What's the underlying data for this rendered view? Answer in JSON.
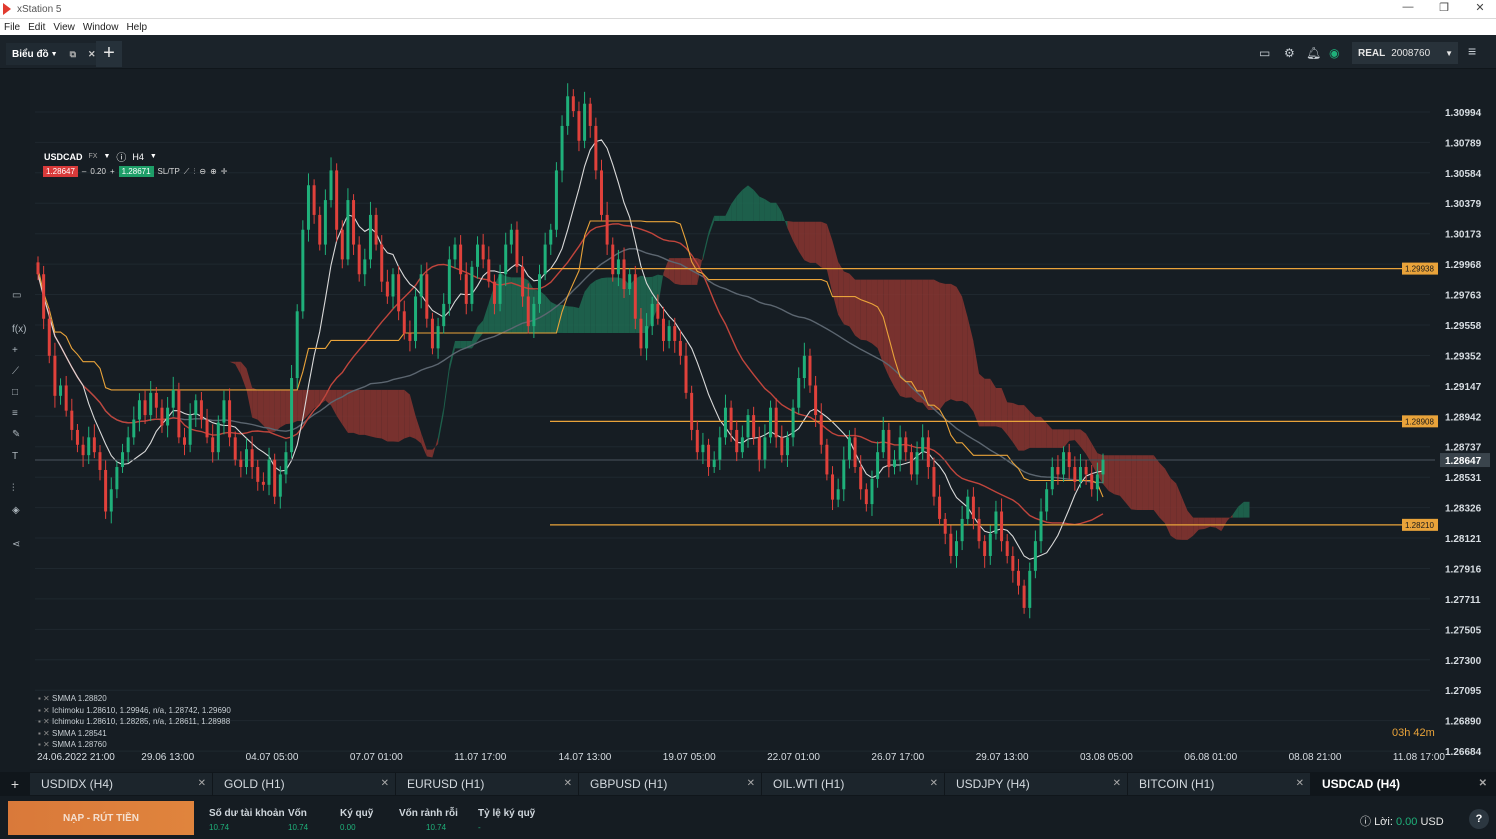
{
  "window": {
    "title": "xStation 5",
    "controls": [
      "—",
      "❐",
      "✕"
    ]
  },
  "menu": [
    "File",
    "Edit",
    "View",
    "Window",
    "Help"
  ],
  "toolbar": {
    "tab_label": "Biểu đồ",
    "account_type": "REAL",
    "account_number": "2008760"
  },
  "instrument": {
    "symbol": "USDCAD",
    "market": "FX",
    "timeframe": "H4",
    "sell": "1.28647",
    "spread": "0.20",
    "buy": "1.28671",
    "sltp": "SL/TP"
  },
  "legend": [
    "SMMA 1.28820",
    "Ichimoku 1.28610, 1.29946, n/a, 1.28742, 1.29690",
    "Ichimoku 1.28610, 1.28285, n/a, 1.28611, 1.28988",
    "SMMA 1.28541",
    "SMMA 1.28760"
  ],
  "countdown": "03h 42m",
  "chart_data": {
    "type": "candlestick",
    "title": "USDCAD (H4)",
    "y_ticks": [
      "1.30994",
      "1.30789",
      "1.30584",
      "1.30379",
      "1.30173",
      "1.29968",
      "1.29763",
      "1.29558",
      "1.29352",
      "1.29147",
      "1.28942",
      "1.28737",
      "1.28531",
      "1.28326",
      "1.28121",
      "1.27916",
      "1.27711",
      "1.27505",
      "1.27300",
      "1.27095",
      "1.26890",
      "1.26684"
    ],
    "y_range": [
      1.26684,
      1.31123
    ],
    "x_ticks": [
      "24.06.2022 21:00",
      "29.06 13:00",
      "04.07 05:00",
      "07.07 01:00",
      "11.07 17:00",
      "14.07 13:00",
      "19.07 05:00",
      "22.07 01:00",
      "26.07 17:00",
      "29.07 13:00",
      "03.08 05:00",
      "06.08 01:00",
      "08.08 21:00",
      "11.08 17:00"
    ],
    "current_price": "1.28647",
    "horizontal_lines": [
      {
        "label": "1.29938",
        "value": 1.29938,
        "color": "#e9a33a"
      },
      {
        "label": "1.28908",
        "value": 1.28908,
        "color": "#e9a33a"
      },
      {
        "label": "1.28210",
        "value": 1.2821,
        "color": "#e9a33a"
      }
    ],
    "colors": {
      "up": "#1fb07a",
      "down": "#e0413b",
      "cloud_up": "#1f6b52",
      "cloud_down": "#8a3530",
      "sma_white": "#d9d9d9",
      "sma_orange": "#e9a33a",
      "sma_red": "#c0453c",
      "sma_gray": "#5c6670"
    },
    "closes": [
      1.299,
      1.296,
      1.2935,
      1.2908,
      1.2915,
      1.2898,
      1.2885,
      1.2875,
      1.2868,
      1.288,
      1.287,
      1.2858,
      1.283,
      1.2845,
      1.286,
      1.287,
      1.288,
      1.2892,
      1.2905,
      1.2895,
      1.291,
      1.29,
      1.2888,
      1.29,
      1.2912,
      1.288,
      1.2875,
      1.2895,
      1.2905,
      1.2892,
      1.288,
      1.287,
      1.289,
      1.2905,
      1.288,
      1.2865,
      1.286,
      1.2872,
      1.286,
      1.285,
      1.2848,
      1.2865,
      1.284,
      1.2855,
      1.287,
      1.292,
      1.2965,
      1.302,
      1.305,
      1.303,
      1.301,
      1.304,
      1.306,
      1.302,
      1.3,
      1.304,
      1.301,
      1.299,
      1.3,
      1.303,
      1.301,
      1.2985,
      1.2975,
      1.299,
      1.2965,
      1.295,
      1.2945,
      1.2975,
      1.299,
      1.296,
      1.294,
      1.2955,
      1.297,
      1.3,
      1.301,
      1.299,
      1.297,
      1.2995,
      1.301,
      1.3,
      1.2985,
      1.297,
      1.299,
      1.301,
      1.302,
      1.2995,
      1.2975,
      1.2955,
      1.297,
      1.299,
      1.301,
      1.302,
      1.306,
      1.309,
      1.311,
      1.31,
      1.308,
      1.3105,
      1.309,
      1.306,
      1.303,
      1.301,
      1.299,
      1.3,
      1.298,
      1.299,
      1.296,
      1.294,
      1.2955,
      1.297,
      1.296,
      1.2945,
      1.2955,
      1.2945,
      1.2935,
      1.291,
      1.2885,
      1.287,
      1.2875,
      1.286,
      1.2865,
      1.288,
      1.29,
      1.2885,
      1.287,
      1.288,
      1.2895,
      1.288,
      1.2865,
      1.288,
      1.29,
      1.288,
      1.2868,
      1.288,
      1.29,
      1.292,
      1.2935,
      1.2915,
      1.2895,
      1.2875,
      1.2855,
      1.2838,
      1.2845,
      1.2865,
      1.288,
      1.286,
      1.2845,
      1.2835,
      1.2852,
      1.287,
      1.2885,
      1.286,
      1.2865,
      1.288,
      1.287,
      1.2855,
      1.287,
      1.288,
      1.286,
      1.284,
      1.2825,
      1.2815,
      1.28,
      1.281,
      1.2825,
      1.284,
      1.2825,
      1.281,
      1.28,
      1.2815,
      1.283,
      1.281,
      1.28,
      1.279,
      1.278,
      1.2765,
      1.279,
      1.281,
      1.283,
      1.2845,
      1.286,
      1.2855,
      1.287,
      1.286,
      1.285,
      1.286,
      1.2855,
      1.2845,
      1.2855,
      1.2865
    ]
  },
  "bottom_tabs": [
    "USDIDX (H4)",
    "GOLD (H1)",
    "EURUSD (H1)",
    "GBPUSD (H1)",
    "OIL.WTI (H1)",
    "USDJPY (H4)",
    "BITCOIN (H1)",
    "USDCAD (H4)"
  ],
  "footer": {
    "deposit_label": "NẠP - RÚT TIỀN",
    "stats": [
      {
        "label": "Số dư tài khoản",
        "value": "10.74"
      },
      {
        "label": "Vốn",
        "value": "10.74"
      },
      {
        "label": "Ký quỹ",
        "value": "0.00"
      },
      {
        "label": "Vốn rảnh rỗi",
        "value": "10.74"
      },
      {
        "label": "Tỷ lệ ký quỹ",
        "value": "-"
      }
    ],
    "profit_label": "Lời:",
    "profit_value": "0.00",
    "currency": "USD"
  }
}
